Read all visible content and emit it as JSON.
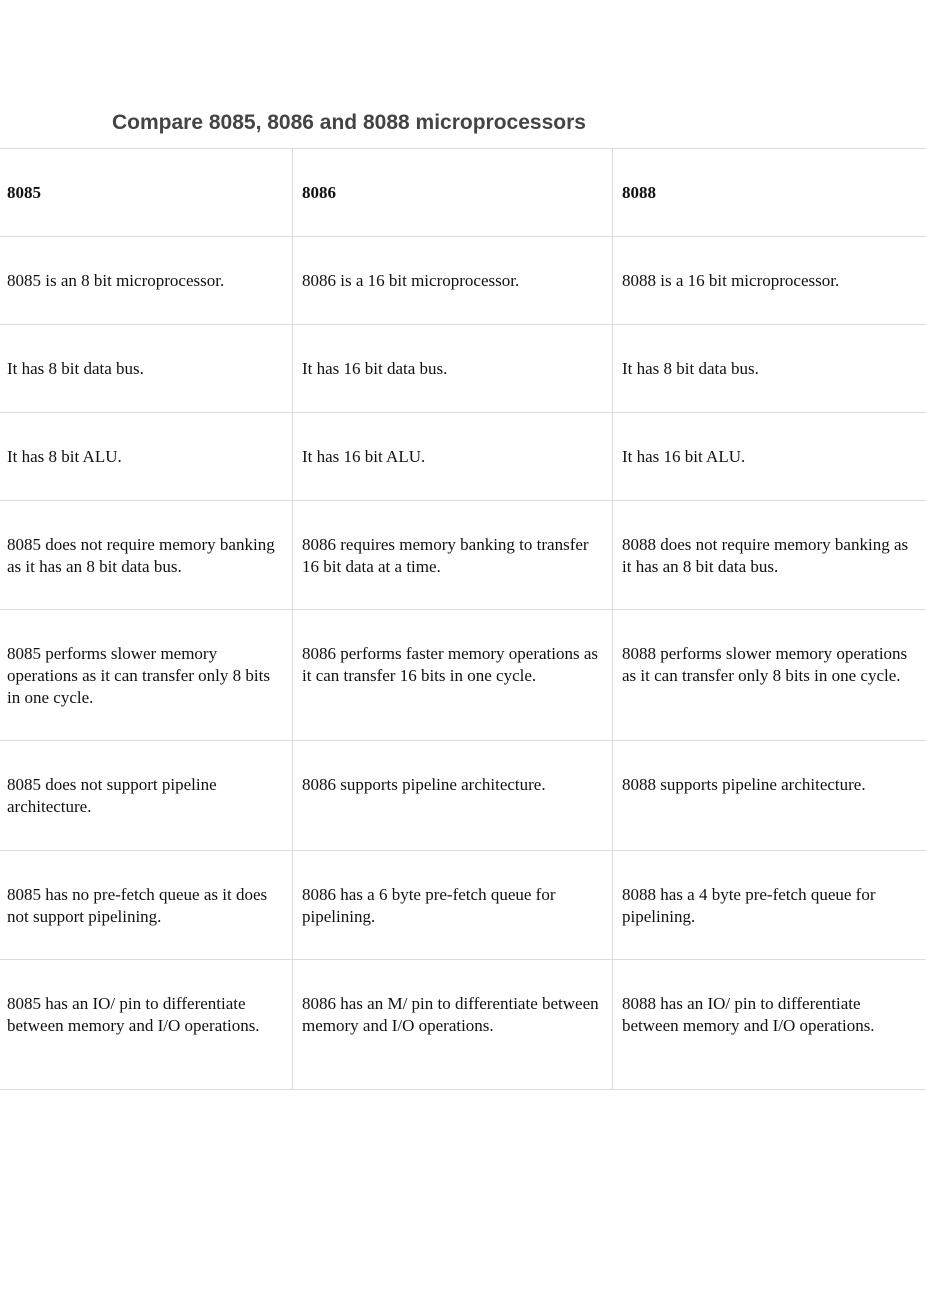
{
  "title": "Compare 8085, 8086 and 8088 microprocessors",
  "table": {
    "header": [
      "8085",
      "8086",
      "8088"
    ],
    "rows": [
      [
        "8085 is an 8 bit microprocessor.",
        "8086 is a 16 bit microprocessor.",
        "8088 is a 16 bit microprocessor."
      ],
      [
        "It has 8 bit data bus.",
        "It has 16 bit data bus.",
        "It has 8 bit data bus."
      ],
      [
        "It has 8 bit ALU.",
        "It has 16 bit ALU.",
        "It has 16 bit ALU."
      ],
      [
        "8085 does not require memory banking as it has an 8 bit data bus.",
        "8086 requires memory banking to transfer 16 bit data at a time.",
        "8088 does not require memory banking as it has an 8 bit data bus."
      ],
      [
        "8085 performs slower memory operations as it can transfer only 8 bits in one cycle.",
        "8086 performs faster memory operations as it can transfer 16 bits in one cycle.",
        "8088 performs slower memory operations as it can transfer only 8 bits in one cycle."
      ],
      [
        "8085 does not support pipeline architecture.",
        "8086 supports pipeline architecture.",
        "8088 supports pipeline architecture."
      ],
      [
        "8085 has no pre-fetch queue as it does not support pipelining.",
        "8086 has a 6 byte pre-fetch queue for pipelining.",
        "8088 has a 4 byte pre-fetch queue for pipelining."
      ],
      [
        "8085 has an IO/ pin to differentiate between memory and I/O operations.",
        "8086 has an M/ pin to differentiate between memory and I/O operations.",
        "8088 has an IO/ pin to differentiate between memory and I/O operations."
      ]
    ]
  }
}
